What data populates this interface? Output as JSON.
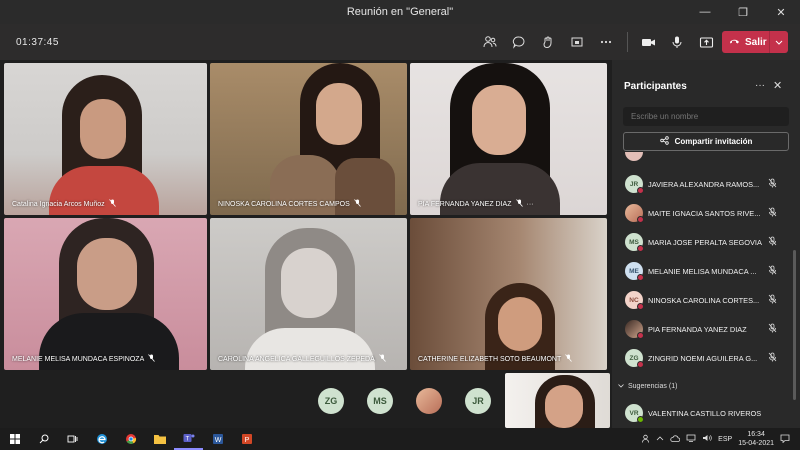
{
  "window": {
    "title": "Reunión en \"General\""
  },
  "meeting": {
    "timer": "01:37:45",
    "leave_label": "Salir"
  },
  "tiles": [
    {
      "name": "Catalina Ignacia Arcos Muñoz"
    },
    {
      "name": "NINOSKA CAROLINA CORTES CAMPOS"
    },
    {
      "name": "PIA FERNANDA YANEZ DIAZ"
    },
    {
      "name": "MELANIE MELISA MUNDACA ESPINOZA"
    },
    {
      "name": "CAROLINA ANGELICA GALLEGUILLOS ZEPEDA"
    },
    {
      "name": "CATHERINE ELIZABETH SOTO BEAUMONT"
    }
  ],
  "tile_more": "···",
  "overflow_avatars": [
    {
      "initials": "ZG"
    },
    {
      "initials": "MS"
    },
    {
      "initials": ""
    },
    {
      "initials": "JR"
    }
  ],
  "panel": {
    "title": "Participantes",
    "more": "···",
    "close": "✕",
    "search_placeholder": "Escribe un nombre",
    "invite_label": "Compartir invitación",
    "participants": [
      {
        "initials": "JR",
        "name": "JAVIERA ALEXANDRA RAMOS..."
      },
      {
        "initials": "",
        "name": "MAITE IGNACIA SANTOS RIVE..."
      },
      {
        "initials": "MS",
        "name": "MARIA JOSE PERALTA SEGOVIA"
      },
      {
        "initials": "ME",
        "name": "MELANIE MELISA MUNDACA ..."
      },
      {
        "initials": "NC",
        "name": "NINOSKA CAROLINA CORTES..."
      },
      {
        "initials": "",
        "name": "PIA FERNANDA YANEZ DIAZ"
      },
      {
        "initials": "ZG",
        "name": "ZINGRID NOEMI AGUILERA G..."
      }
    ],
    "suggestions_label": "Sugerencias (1)",
    "suggestions": [
      {
        "initials": "VR",
        "name": "VALENTINA CASTILLO RIVEROS"
      }
    ]
  },
  "taskbar": {
    "lang": "ESP",
    "time": "16:34",
    "date": "15-04-2021"
  },
  "colors": {
    "leave": "#c4314b",
    "avatar_bg": "#cfe2cf",
    "avatar_fg": "#3c5a3c",
    "panel_bg": "#292929"
  }
}
